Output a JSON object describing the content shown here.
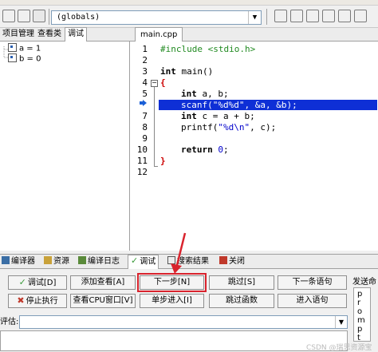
{
  "toolbar": {
    "scope_value": "(globals)",
    "scope_arrow": "▼"
  },
  "left_panel": {
    "tabs": [
      "项目管理",
      "查看类",
      "调试"
    ],
    "watch_vars": [
      "a = 1",
      "b = 0"
    ]
  },
  "editor": {
    "tab": "main.cpp",
    "line_numbers": [
      "1",
      "2",
      "3",
      "4",
      "5",
      "6",
      "7",
      "8",
      "9",
      "10",
      "11",
      "12"
    ],
    "fold_open": "−",
    "lines": {
      "l1": "#include <stdio.h>",
      "l3_kw": "int",
      "l3_rest": " main()",
      "l4": "{",
      "l5_kw": "int",
      "l5_rest": " a, b;",
      "l6_a": "scanf(",
      "l6_str": "\"%d%d\"",
      "l6_b": ", &a, &b);",
      "l7_kw": "int",
      "l7_rest": " c = a + b;",
      "l8_a": "printf(",
      "l8_str": "\"%d\\n\"",
      "l8_b": ", c);",
      "l10_kw": "return",
      "l10_sp": " ",
      "l10_num": "0",
      "l10_end": ";",
      "l11": "}"
    },
    "marker_color": "#1a5fd6",
    "highlight_color": "#0e2fd6"
  },
  "bottom_tabs": [
    "编译器",
    "资源",
    "编译日志",
    "调试",
    "搜索结果",
    "关闭"
  ],
  "debug": {
    "buttons": {
      "debug": "调试[D]",
      "add_watch": "添加查看[A]",
      "next": "下一步[N]",
      "skip": "跳过[S]",
      "next_stmt": "下一条语句",
      "stop": "停止执行",
      "view_cpu": "查看CPU窗口[V]",
      "step_into": "单步进入[I]",
      "skip_func": "跳过函数",
      "into_stmt": "进入语句"
    },
    "eval_label": "评估:",
    "eval_arrow": "▼",
    "send_label": "发送命",
    "send_text": [
      "p",
      "r",
      "o",
      "m",
      "p",
      "t"
    ]
  },
  "annotation": {
    "color": "#d9232d"
  },
  "watermark": "CSDN @瑞思资源宝"
}
